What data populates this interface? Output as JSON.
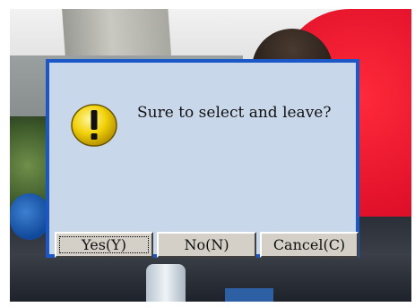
{
  "dialog": {
    "message": "Sure to select and leave?",
    "icon": "warning-exclamation-icon",
    "buttons": {
      "yes": "Yes(Y)",
      "no": "No(N)",
      "cancel": "Cancel(C)"
    },
    "focused_button": "yes"
  },
  "colors": {
    "dialog_border": "#1c57c8",
    "dialog_background": "#c8d7ea",
    "button_face": "#d4d0c8",
    "icon_yellow": "#f2d20a"
  }
}
